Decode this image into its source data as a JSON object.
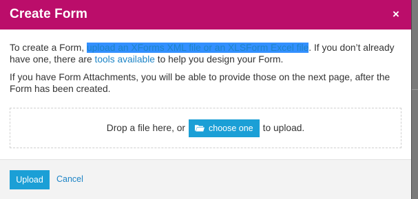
{
  "modal": {
    "title": "Create Form",
    "close_label": "×"
  },
  "body": {
    "paragraph1": {
      "prefix": "To create a Form, ",
      "link_upload": "upload an XForms XML file or an XLSForm Excel file",
      "middle": ". If you don’t already have one, there are ",
      "link_tools": "tools available",
      "suffix": " to help you design your Form."
    },
    "paragraph2": "If you have Form Attachments, you will be able to provide those on the next page, after the Form has been created."
  },
  "dropzone": {
    "prefix": "Drop a file here, or",
    "button_label": "choose one",
    "suffix": "to upload."
  },
  "footer": {
    "upload_label": "Upload",
    "cancel_label": "Cancel"
  },
  "icons": {
    "close": "close-icon",
    "choose": "folder-open-icon"
  },
  "colors": {
    "header": "#bb0d6a",
    "primary_button": "#1b9fd6",
    "link": "#1d84c6",
    "selection": "#3390ff"
  }
}
